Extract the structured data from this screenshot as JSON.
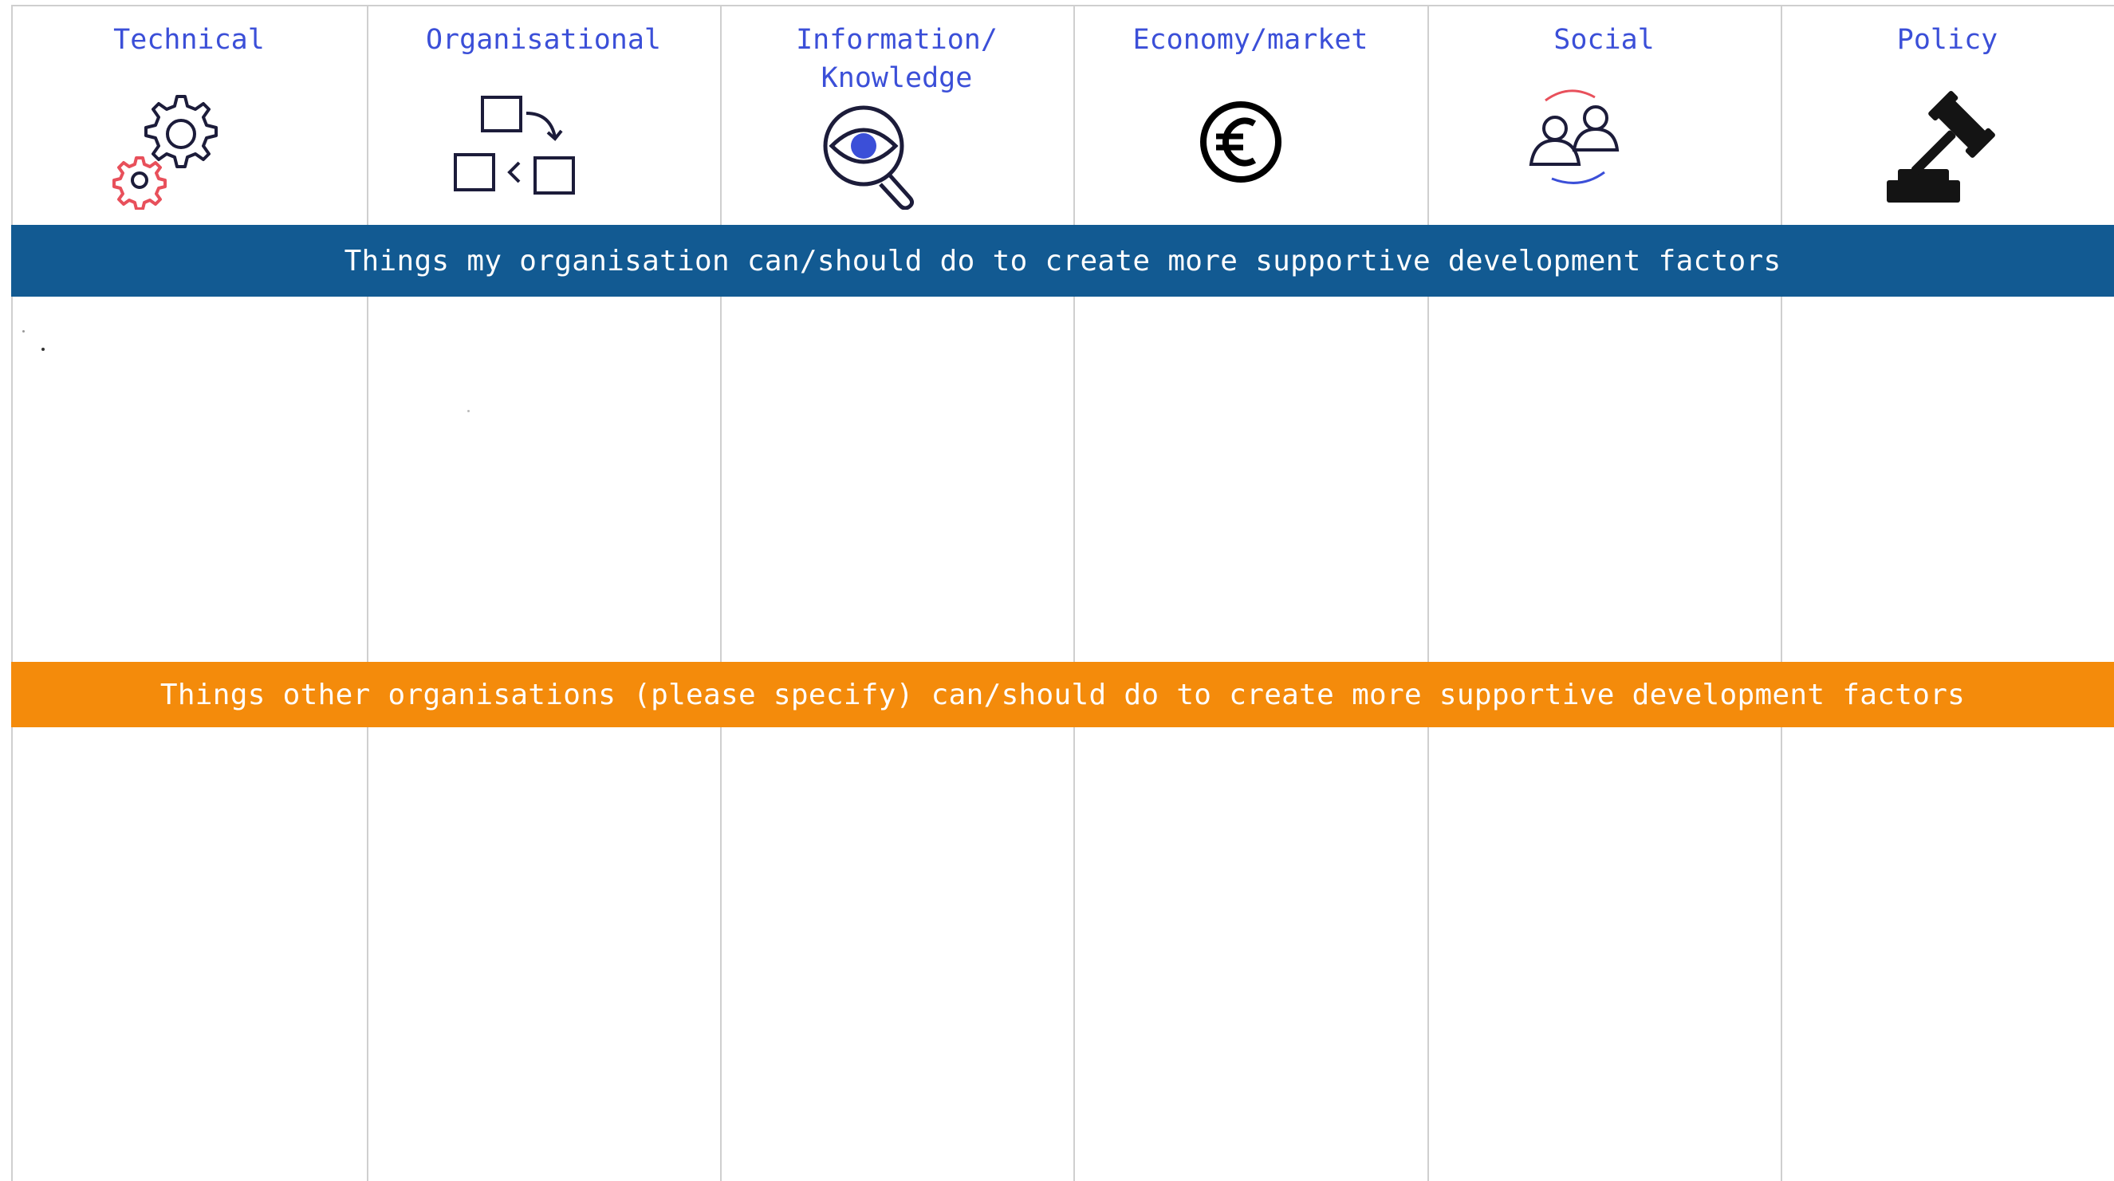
{
  "columns": [
    {
      "label": "Technical",
      "icon": "gears-icon"
    },
    {
      "label": "Organisational",
      "icon": "flow-boxes-icon"
    },
    {
      "label": "Information/\nKnowledge",
      "icon": "eye-magnifier-icon"
    },
    {
      "label": "Economy/market",
      "icon": "euro-coin-icon"
    },
    {
      "label": "Social",
      "icon": "people-exchange-icon"
    },
    {
      "label": "Policy",
      "icon": "gavel-icon"
    }
  ],
  "bands": {
    "own": "Things my organisation can/should do to create more supportive development factors",
    "other": "Things other organisations (please specify) can/should do to create more supportive development factors"
  },
  "colors": {
    "header_text": "#3b4fd8",
    "band_blue": "#125a92",
    "band_orange": "#f48b0b",
    "grid": "#cfcfcf",
    "accent_red": "#e8505b"
  }
}
